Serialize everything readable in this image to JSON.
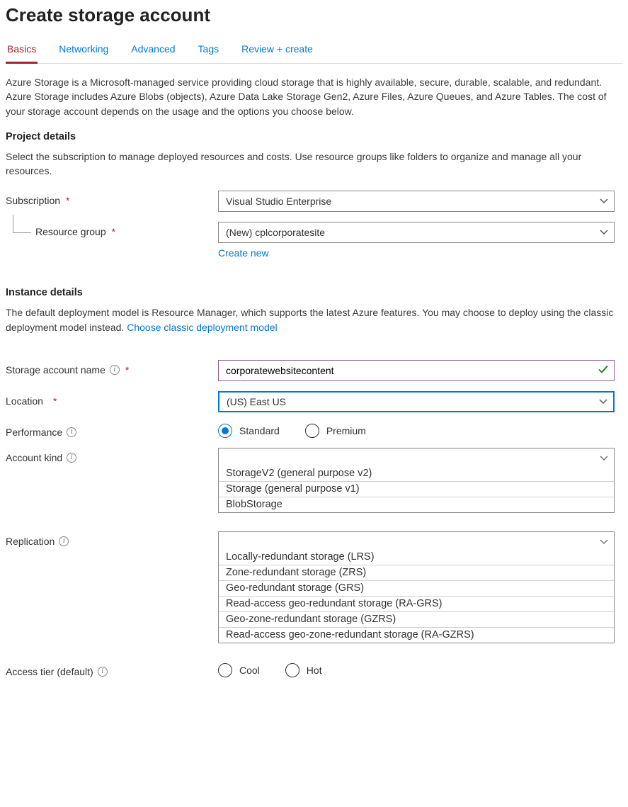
{
  "page_title": "Create storage account",
  "tabs": [
    "Basics",
    "Networking",
    "Advanced",
    "Tags",
    "Review + create"
  ],
  "active_tab_index": 0,
  "intro": "Azure Storage is a Microsoft-managed service providing cloud storage that is highly available, secure, durable, scalable, and redundant. Azure Storage includes Azure Blobs (objects), Azure Data Lake Storage Gen2, Azure Files, Azure Queues, and Azure Tables. The cost of your storage account depends on the usage and the options you choose below.",
  "project_details": {
    "heading": "Project details",
    "desc": "Select the subscription to manage deployed resources and costs. Use resource groups like folders to organize and manage all your resources.",
    "subscription_label": "Subscription",
    "subscription_value": "Visual Studio Enterprise",
    "resource_group_label": "Resource group",
    "resource_group_value": "(New) cplcorporatesite",
    "create_new_link": "Create new"
  },
  "instance_details": {
    "heading": "Instance details",
    "desc_prefix": "The default deployment model is Resource Manager, which supports the latest Azure features. You may choose to deploy using the classic deployment model instead.  ",
    "classic_link": "Choose classic deployment model",
    "name_label": "Storage account name",
    "name_value": "corporatewebsitecontent",
    "location_label": "Location",
    "location_value": "(US) East US",
    "performance_label": "Performance",
    "performance_options": [
      "Standard",
      "Premium"
    ],
    "performance_selected": "Standard",
    "account_kind_label": "Account kind",
    "account_kind_options": [
      "StorageV2 (general purpose v2)",
      "Storage (general purpose v1)",
      "BlobStorage"
    ],
    "replication_label": "Replication",
    "replication_options": [
      "Locally-redundant storage (LRS)",
      "Zone-redundant storage (ZRS)",
      "Geo-redundant storage (GRS)",
      "Read-access geo-redundant storage (RA-GRS)",
      "Geo-zone-redundant storage (GZRS)",
      "Read-access geo-zone-redundant storage (RA-GZRS)"
    ],
    "access_tier_label": "Access tier (default)",
    "access_tier_options": [
      "Cool",
      "Hot"
    ],
    "access_tier_selected": null
  }
}
